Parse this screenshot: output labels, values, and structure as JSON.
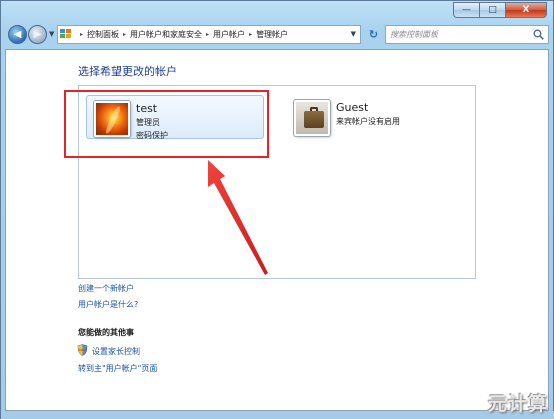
{
  "window": {
    "controls": {
      "minimize": "—",
      "maximize": "□",
      "close": "X"
    }
  },
  "nav": {
    "back_icon": "left-arrow-icon",
    "forward_icon": "right-arrow-icon"
  },
  "address": {
    "breadcrumbs": [
      "控制面板",
      "用户帐户和家庭安全",
      "用户帐户",
      "管理帐户"
    ],
    "separator": "▸"
  },
  "search": {
    "placeholder": "搜索控制面板"
  },
  "main": {
    "heading": "选择希望更改的帐户",
    "accounts": [
      {
        "name": "test",
        "line1": "管理员",
        "line2": "密码保护",
        "picture": "orange-flower"
      },
      {
        "name": "Guest",
        "line1": "来宾帐户没有启用",
        "line2": "",
        "picture": "suitcase"
      }
    ],
    "links": {
      "create_account": "创建一个新帐户",
      "what_is_account": "用户帐户是什么?"
    },
    "other_heading": "您能做的其他事",
    "other_links": {
      "parental_controls": "设置家长控制",
      "goto_main": "转到主\"用户帐户\"页面"
    }
  },
  "annotation": {
    "color": "#e0262a"
  },
  "watermark": "元计算"
}
